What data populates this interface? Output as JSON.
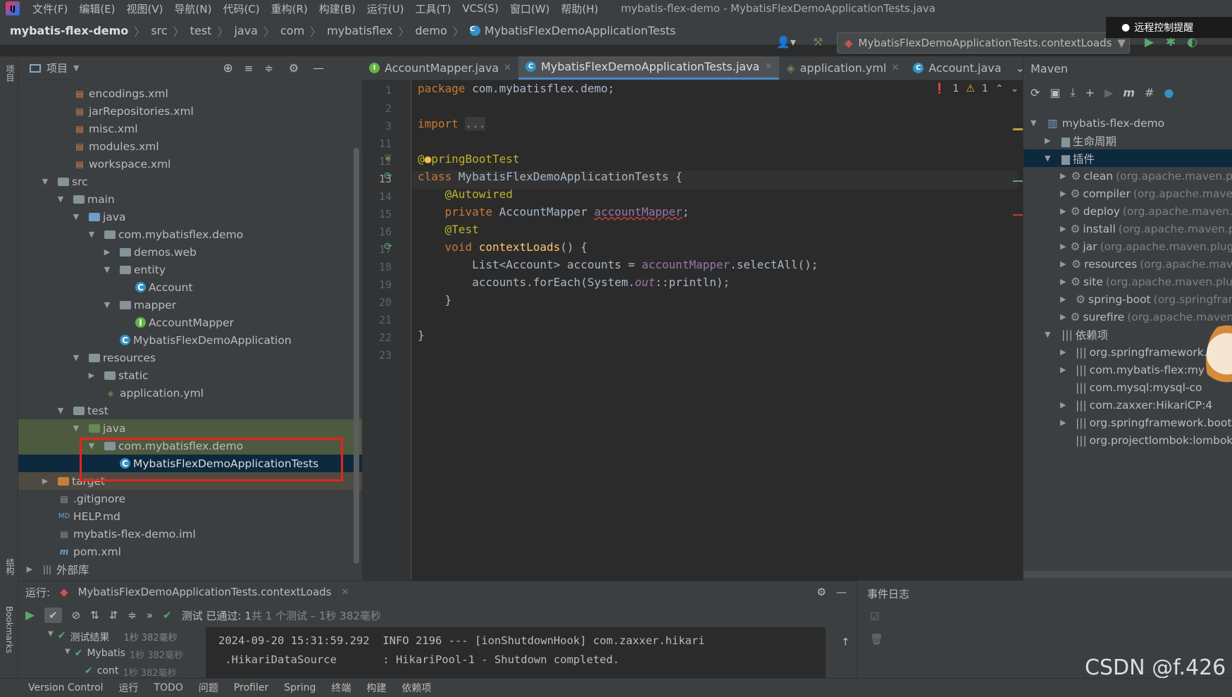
{
  "menubar": {
    "items": [
      "文件(F)",
      "编辑(E)",
      "视图(V)",
      "导航(N)",
      "代码(C)",
      "重构(R)",
      "构建(B)",
      "运行(U)",
      "工具(T)",
      "VCS(S)",
      "窗口(W)",
      "帮助(H)"
    ],
    "window_title": "mybatis-flex-demo - MybatisFlexDemoApplicationTests.java",
    "remote_notice": "远程控制提醒"
  },
  "breadcrumb": [
    "mybatis-flex-demo",
    "src",
    "test",
    "java",
    "com",
    "mybatisflex",
    "demo",
    "MybatisFlexDemoApplicationTests"
  ],
  "run_config": "MybatisFlexDemoApplicationTests.contextLoads",
  "project_panel": {
    "title": "项目",
    "tree": [
      {
        "label": "encodings.xml",
        "icon": "xml"
      },
      {
        "label": "jarRepositories.xml",
        "icon": "xml"
      },
      {
        "label": "misc.xml",
        "icon": "xml"
      },
      {
        "label": "modules.xml",
        "icon": "xml"
      },
      {
        "label": "workspace.xml",
        "icon": "xml"
      },
      {
        "label": "src",
        "icon": "folder"
      },
      {
        "label": "main",
        "icon": "folder"
      },
      {
        "label": "java",
        "icon": "folder-blue"
      },
      {
        "label": "com.mybatisflex.demo",
        "icon": "package"
      },
      {
        "label": "demos.web",
        "icon": "package"
      },
      {
        "label": "entity",
        "icon": "package"
      },
      {
        "label": "Account",
        "icon": "class"
      },
      {
        "label": "mapper",
        "icon": "package"
      },
      {
        "label": "AccountMapper",
        "icon": "interface"
      },
      {
        "label": "MybatisFlexDemoApplication",
        "icon": "spring-class"
      },
      {
        "label": "resources",
        "icon": "folder-res"
      },
      {
        "label": "static",
        "icon": "folder"
      },
      {
        "label": "application.yml",
        "icon": "yml"
      },
      {
        "label": "test",
        "icon": "folder"
      },
      {
        "label": "java",
        "icon": "folder-green"
      },
      {
        "label": "com.mybatisflex.demo",
        "icon": "package"
      },
      {
        "label": "MybatisFlexDemoApplicationTests",
        "icon": "spring-class"
      },
      {
        "label": "target",
        "icon": "folder-orange"
      },
      {
        "label": ".gitignore",
        "icon": "file"
      },
      {
        "label": "HELP.md",
        "icon": "md"
      },
      {
        "label": "mybatis-flex-demo.iml",
        "icon": "file"
      },
      {
        "label": "pom.xml",
        "icon": "maven"
      },
      {
        "label": "外部库",
        "icon": "lib"
      }
    ]
  },
  "editor": {
    "tabs": [
      "AccountMapper.java",
      "MybatisFlexDemoApplicationTests.java",
      "application.yml",
      "Account.java"
    ],
    "active_tab": 1,
    "line_numbers": [
      "1",
      "2",
      "3",
      "11",
      "12",
      "13",
      "14",
      "15",
      "16",
      "17",
      "18",
      "19",
      "20",
      "21",
      "22",
      "23"
    ],
    "inspections": {
      "errors": "1",
      "warnings": "1"
    }
  },
  "maven": {
    "title": "Maven",
    "project": "mybatis-flex-demo",
    "lifecycle": "生命周期",
    "plugins_label": "插件",
    "plugins": [
      {
        "name": "clean",
        "group": "(org.apache.maven.p"
      },
      {
        "name": "compiler",
        "group": "(org.apache.mave"
      },
      {
        "name": "deploy",
        "group": "(org.apache.maven."
      },
      {
        "name": "install",
        "group": "(org.apache.maven.p"
      },
      {
        "name": "jar",
        "group": "(org.apache.maven.plug"
      },
      {
        "name": "resources",
        "group": "(org.apache.mav"
      },
      {
        "name": "site",
        "group": "(org.apache.maven.plu"
      },
      {
        "name": "spring-boot",
        "group": "(org.springfrar"
      },
      {
        "name": "surefire",
        "group": "(org.apache.maven"
      }
    ],
    "deps_label": "依赖项",
    "deps": [
      "org.springframework.b",
      "com.mybatis-flex:my",
      "com.mysql:mysql-co",
      "com.zaxxer:HikariCP:4",
      "org.springframework.boot",
      "org.projectlombok:lombok"
    ]
  },
  "run_panel": {
    "label": "运行:",
    "config": "MybatisFlexDemoApplicationTests.contextLoads",
    "status_prefix": "测试 已通过: ",
    "status_count": "1",
    "status_suffix": "共 1 个测试 – 1秒 382毫秒",
    "tree": [
      {
        "label": "测试结果",
        "time": "1秒 382毫秒"
      },
      {
        "label": "Mybatis",
        "time": "1秒 382毫秒"
      },
      {
        "label": "cont",
        "time": "1秒 382毫秒"
      }
    ],
    "console": [
      "2024-09-20 15:31:59.292  INFO 2196 --- [ionShutdownHook] com.zaxxer.hikari",
      " .HikariDataSource       : HikariPool-1 - Shutdown completed."
    ]
  },
  "event_log": "事件日志",
  "statusbar": [
    "Version Control",
    "运行",
    "TODO",
    "问题",
    "Profiler",
    "Spring",
    "终端",
    "构建",
    "依赖项"
  ],
  "left_strip": [
    "项目",
    "结构",
    "Bookmarks"
  ],
  "watermark": "CSDN @f.426"
}
